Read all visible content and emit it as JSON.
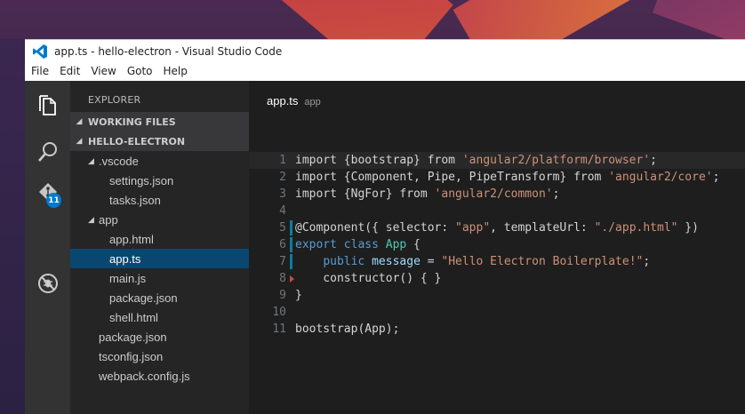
{
  "window": {
    "title": "app.ts - hello-electron - Visual Studio Code"
  },
  "menu": [
    "File",
    "Edit",
    "View",
    "Goto",
    "Help"
  ],
  "activity_bar": {
    "items": [
      {
        "icon": "files-icon"
      },
      {
        "icon": "search-icon"
      },
      {
        "icon": "git-icon",
        "badge": "11"
      },
      {
        "icon": "debug-icon"
      }
    ]
  },
  "sidebar": {
    "title": "EXPLORER",
    "working_files": "WORKING FILES",
    "project": "HELLO-ELECTRON",
    "tree": [
      {
        "label": ".vscode",
        "type": "folder"
      },
      {
        "label": "settings.json",
        "type": "file"
      },
      {
        "label": "tasks.json",
        "type": "file"
      },
      {
        "label": "app",
        "type": "folder"
      },
      {
        "label": "app.html",
        "type": "file"
      },
      {
        "label": "app.ts",
        "type": "file",
        "selected": true
      },
      {
        "label": "main.js",
        "type": "file"
      },
      {
        "label": "package.json",
        "type": "file"
      },
      {
        "label": "shell.html",
        "type": "file"
      },
      {
        "label": "package.json",
        "type": "file"
      },
      {
        "label": "tsconfig.json",
        "type": "file"
      },
      {
        "label": "webpack.config.js",
        "type": "file"
      }
    ]
  },
  "editor": {
    "tab_name": "app.ts",
    "tab_path": "app",
    "lines": [
      {
        "n": "1",
        "tokens": [
          [
            "plain",
            "import {bootstrap} from "
          ],
          [
            "str",
            "'angular2/platform/browser'"
          ],
          [
            "plain",
            ";"
          ]
        ]
      },
      {
        "n": "2",
        "tokens": [
          [
            "plain",
            "import {Component, Pipe, PipeTransform} from "
          ],
          [
            "str",
            "'angular2/core'"
          ],
          [
            "plain",
            ";"
          ]
        ]
      },
      {
        "n": "3",
        "tokens": [
          [
            "plain",
            "import {NgFor} from "
          ],
          [
            "str",
            "'angular2/common'"
          ],
          [
            "plain",
            ";"
          ]
        ]
      },
      {
        "n": "4",
        "tokens": []
      },
      {
        "n": "5",
        "tokens": [
          [
            "plain",
            "@Component({ selector: "
          ],
          [
            "str",
            "\"app\""
          ],
          [
            "plain",
            ", templateUrl: "
          ],
          [
            "str",
            "\"./app.html\""
          ],
          [
            "plain",
            " })"
          ]
        ]
      },
      {
        "n": "6",
        "tokens": [
          [
            "kw",
            "export class "
          ],
          [
            "cls",
            "App"
          ],
          [
            "plain",
            " {"
          ]
        ]
      },
      {
        "n": "7",
        "tokens": [
          [
            "plain",
            "    "
          ],
          [
            "kw",
            "public "
          ],
          [
            "prop",
            "message"
          ],
          [
            "plain",
            " = "
          ],
          [
            "str",
            "\"Hello Electron Boilerplate!\""
          ],
          [
            "plain",
            ";"
          ]
        ]
      },
      {
        "n": "8",
        "tokens": [
          [
            "plain",
            "    constructor() { }"
          ]
        ]
      },
      {
        "n": "9",
        "tokens": [
          [
            "plain",
            "}"
          ]
        ]
      },
      {
        "n": "10",
        "tokens": []
      },
      {
        "n": "11",
        "tokens": [
          [
            "plain",
            "bootstrap(App);"
          ]
        ]
      }
    ]
  }
}
